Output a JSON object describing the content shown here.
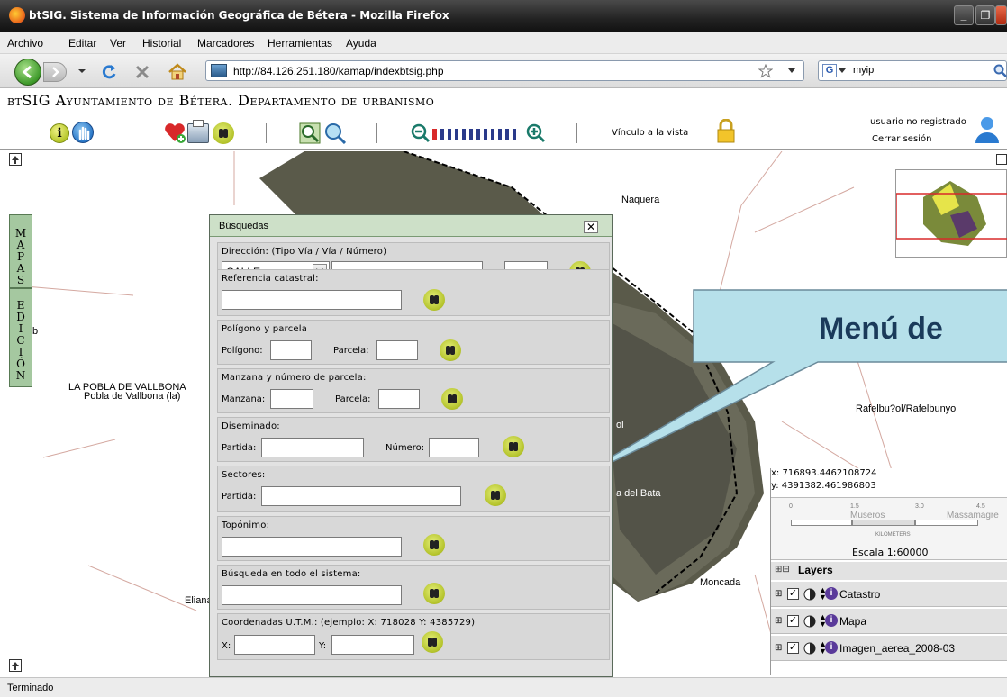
{
  "window": {
    "title": "btSIG. Sistema de Información Geográfica de Bétera - Mozilla Firefox",
    "minimize": "_",
    "maximize": "❐",
    "close": "✕"
  },
  "menu": [
    "Archivo",
    "Editar",
    "Ver",
    "Historial",
    "Marcadores",
    "Herramientas",
    "Ayuda"
  ],
  "nav": {
    "url": "http://84.126.251.180/kamap/indexbtsig.php",
    "search_value": "myip"
  },
  "app": {
    "title": "btSIG Ayuntamiento de Bétera. Departamento de urbanismo",
    "vinculo": "Vínculo a la vista",
    "user_status": "usuario no registrado",
    "logout": "Cerrar sesión"
  },
  "side_tabs": {
    "mapas": [
      "M",
      "A",
      "P",
      "A",
      "S"
    ],
    "edicion": [
      "E",
      "D",
      "I",
      "C",
      "I",
      "Ó",
      "N"
    ]
  },
  "map_labels": {
    "naquera": "Naquera",
    "pobla1": "LA POBLA DE VALLBONA",
    "pobla2": "Pobla de Vallbona (la)",
    "rafelbunyol": "Rafelbu?ol/Rafelbunyol",
    "moncada": "Moncada",
    "eliana": "Eliana",
    "callout": "Menú de",
    "partial_b": "b",
    "partial_ol": "ol",
    "partial_bata": "a del Bata"
  },
  "panel": {
    "title": "Búsquedas",
    "close": "✕",
    "direccion_label": "Dirección: (Tipo Vía / Vía / Número)",
    "via_type": "CALLE",
    "refcat_label": "Referencia catastral:",
    "poligono_section": "Polígono y parcela",
    "poligono_label": "Polígono:",
    "parcela_label": "Parcela:",
    "manzana_section": "Manzana y número de parcela:",
    "manzana_label": "Manzana:",
    "parcela_label2": "Parcela:",
    "diseminado_section": "Diseminado:",
    "partida_label": "Partida:",
    "numero_label": "Número:",
    "sectores_section": "Sectores:",
    "partida_label2": "Partida:",
    "toponimo_label": "Topónimo:",
    "busqueda_label": "Búsqueda en todo el sistema:",
    "coord_label": "Coordenadas U.T.M.: (ejemplo: X: 718028 Y: 4385729)",
    "x_label": "X:",
    "y_label": "Y:"
  },
  "right_panel": {
    "coord_x": "x: 716893.4462108724",
    "coord_y": "y: 4391382.461986803",
    "scale_ticks": [
      "0",
      "1.5",
      "3.0",
      "4.5"
    ],
    "scale_units": "KILOMETERS",
    "scale_text": "Escala 1:60000",
    "museros": "Museros",
    "massamagre": "Massamagre",
    "layers_header": "Layers",
    "layers": [
      "Catastro",
      "Mapa",
      "Imagen_aerea_2008-03"
    ]
  },
  "status": "Terminado",
  "colors": {
    "panel_header": "#cde0c8",
    "side_tab": "#a5c8a0",
    "callout_fill": "#b6e0ea",
    "binoculars": "#b3c22a"
  }
}
